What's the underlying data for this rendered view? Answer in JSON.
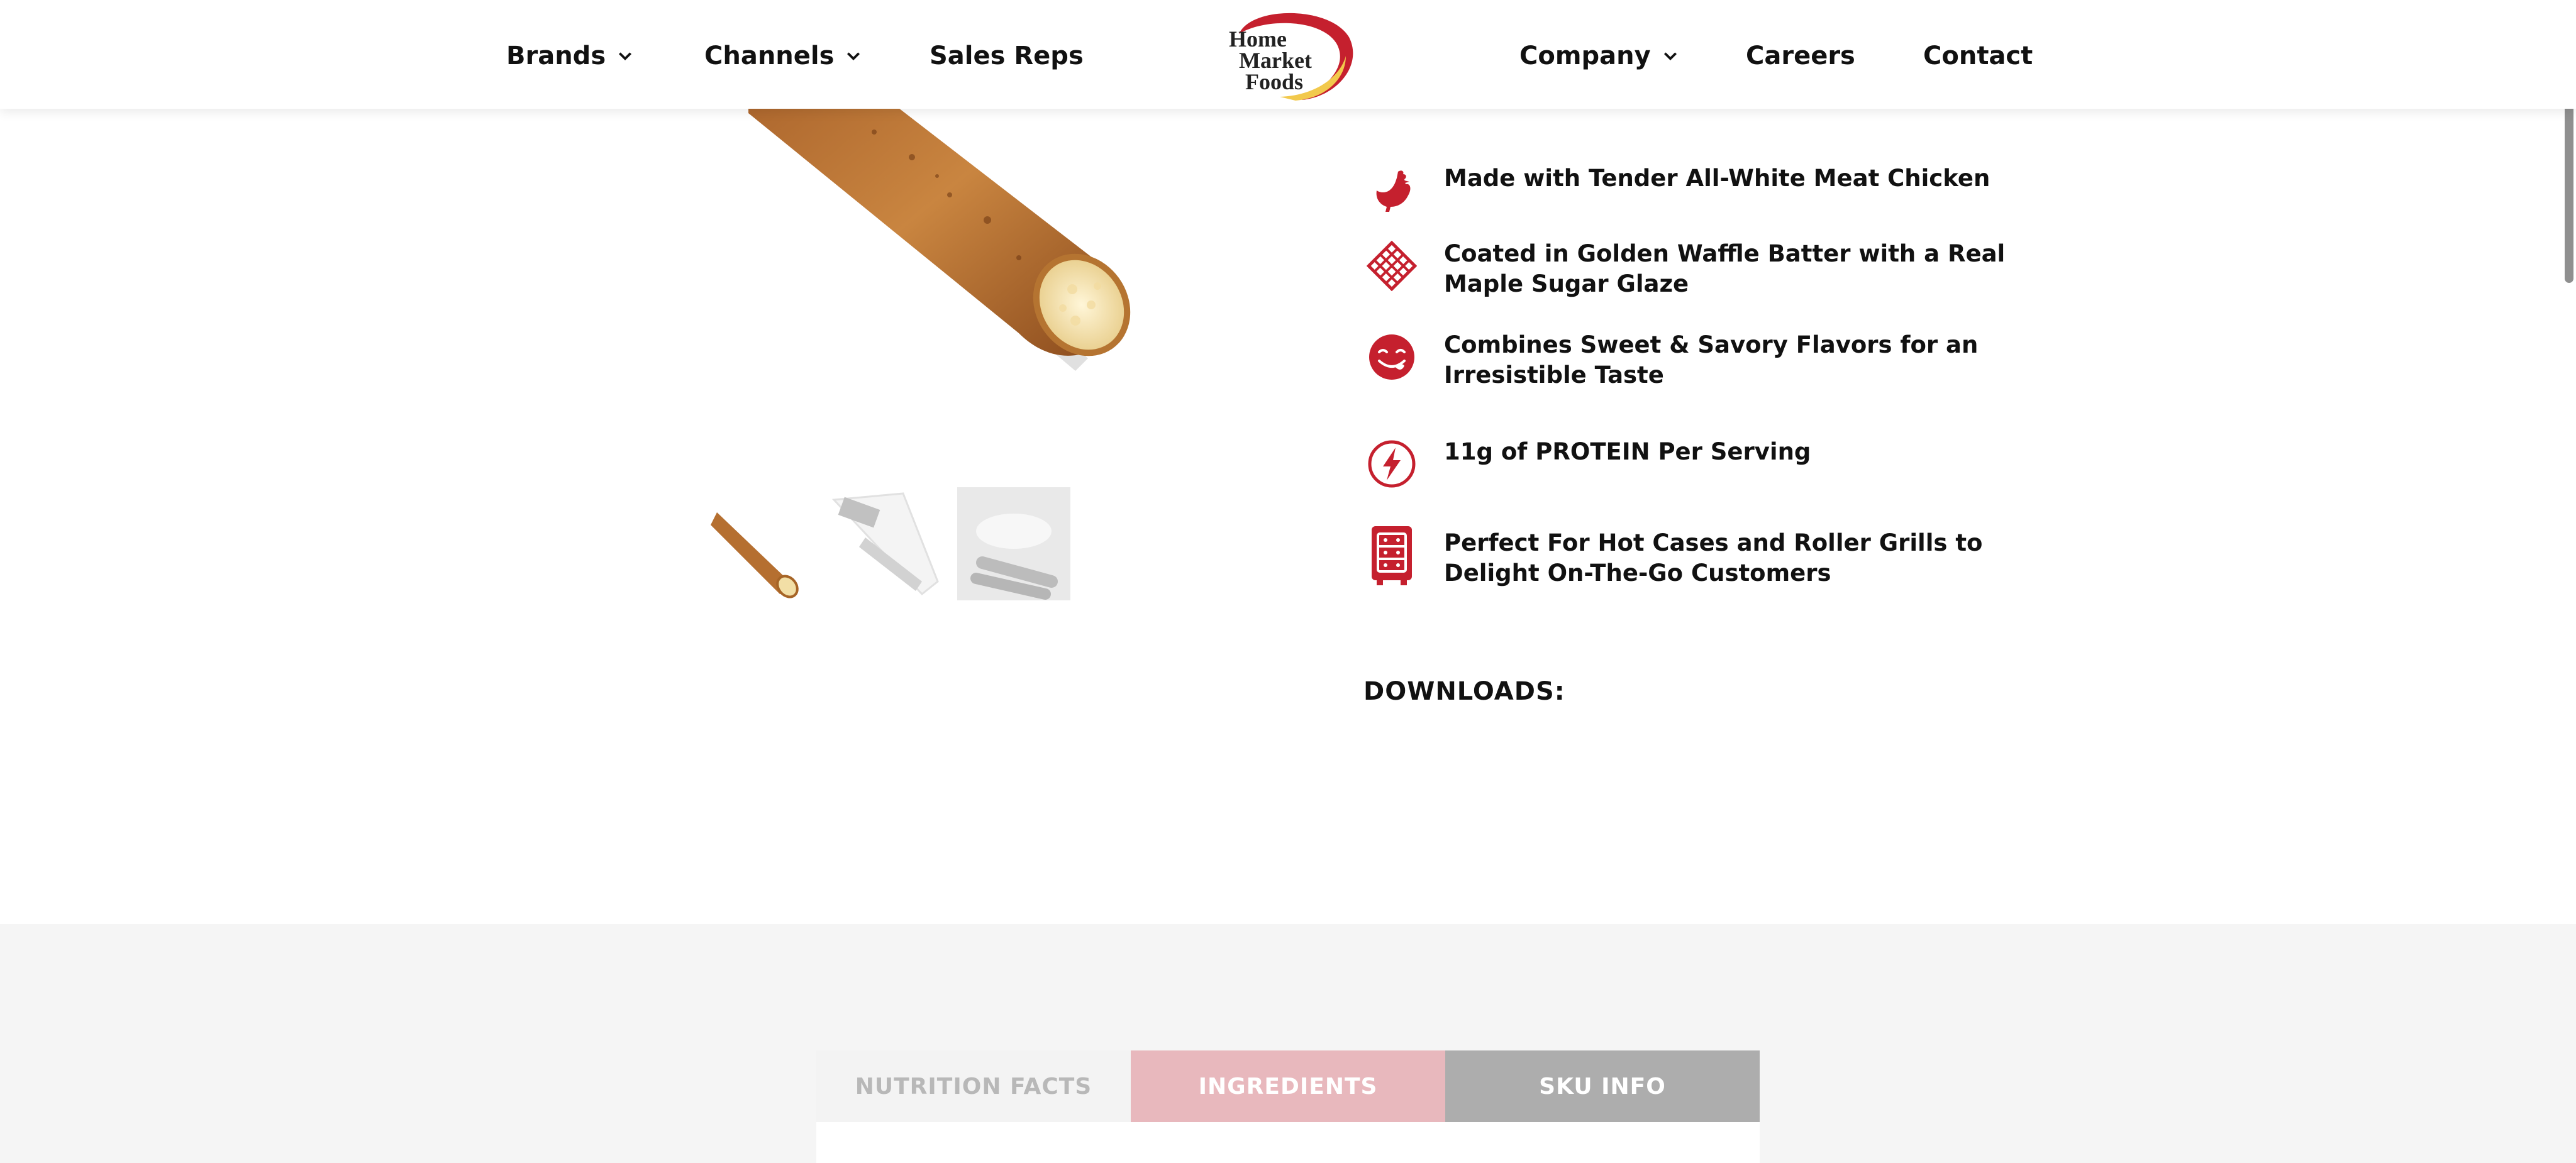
{
  "nav": {
    "left": [
      {
        "label": "Brands",
        "has_dropdown": true
      },
      {
        "label": "Channels",
        "has_dropdown": true
      },
      {
        "label": "Sales Reps",
        "has_dropdown": false
      }
    ],
    "right": [
      {
        "label": "Company",
        "has_dropdown": true
      },
      {
        "label": "Careers",
        "has_dropdown": false
      },
      {
        "label": "Contact",
        "has_dropdown": false
      }
    ],
    "logo": {
      "line1": "Home",
      "line2": "Market",
      "line3": "Foods"
    }
  },
  "product": {
    "thumbnails": [
      {
        "name": "product-stick",
        "selected": true
      },
      {
        "name": "product-package",
        "selected": false
      },
      {
        "name": "product-serving",
        "selected": false
      }
    ]
  },
  "features": [
    {
      "icon": "chicken-icon",
      "text": "Made with Tender All-White Meat Chicken"
    },
    {
      "icon": "waffle-icon",
      "text": "Coated in Golden Waffle Batter with a Real Maple Sugar Glaze"
    },
    {
      "icon": "tongue-face-icon",
      "text": "Combines Sweet & Savory Flavors for an Irresistible Taste"
    },
    {
      "icon": "lightning-icon",
      "text": "11g of PROTEIN Per Serving"
    },
    {
      "icon": "roller-grill-icon",
      "text": "Perfect For Hot Cases and Roller Grills to Delight On-The-Go Customers"
    }
  ],
  "downloads_label": "DOWNLOADS:",
  "tabs": [
    {
      "label": "NUTRITION FACTS"
    },
    {
      "label": "INGREDIENTS"
    },
    {
      "label": "SKU INFO"
    }
  ],
  "colors": {
    "brand_red": "#c5202e",
    "brand_yellow": "#f2c94c"
  }
}
